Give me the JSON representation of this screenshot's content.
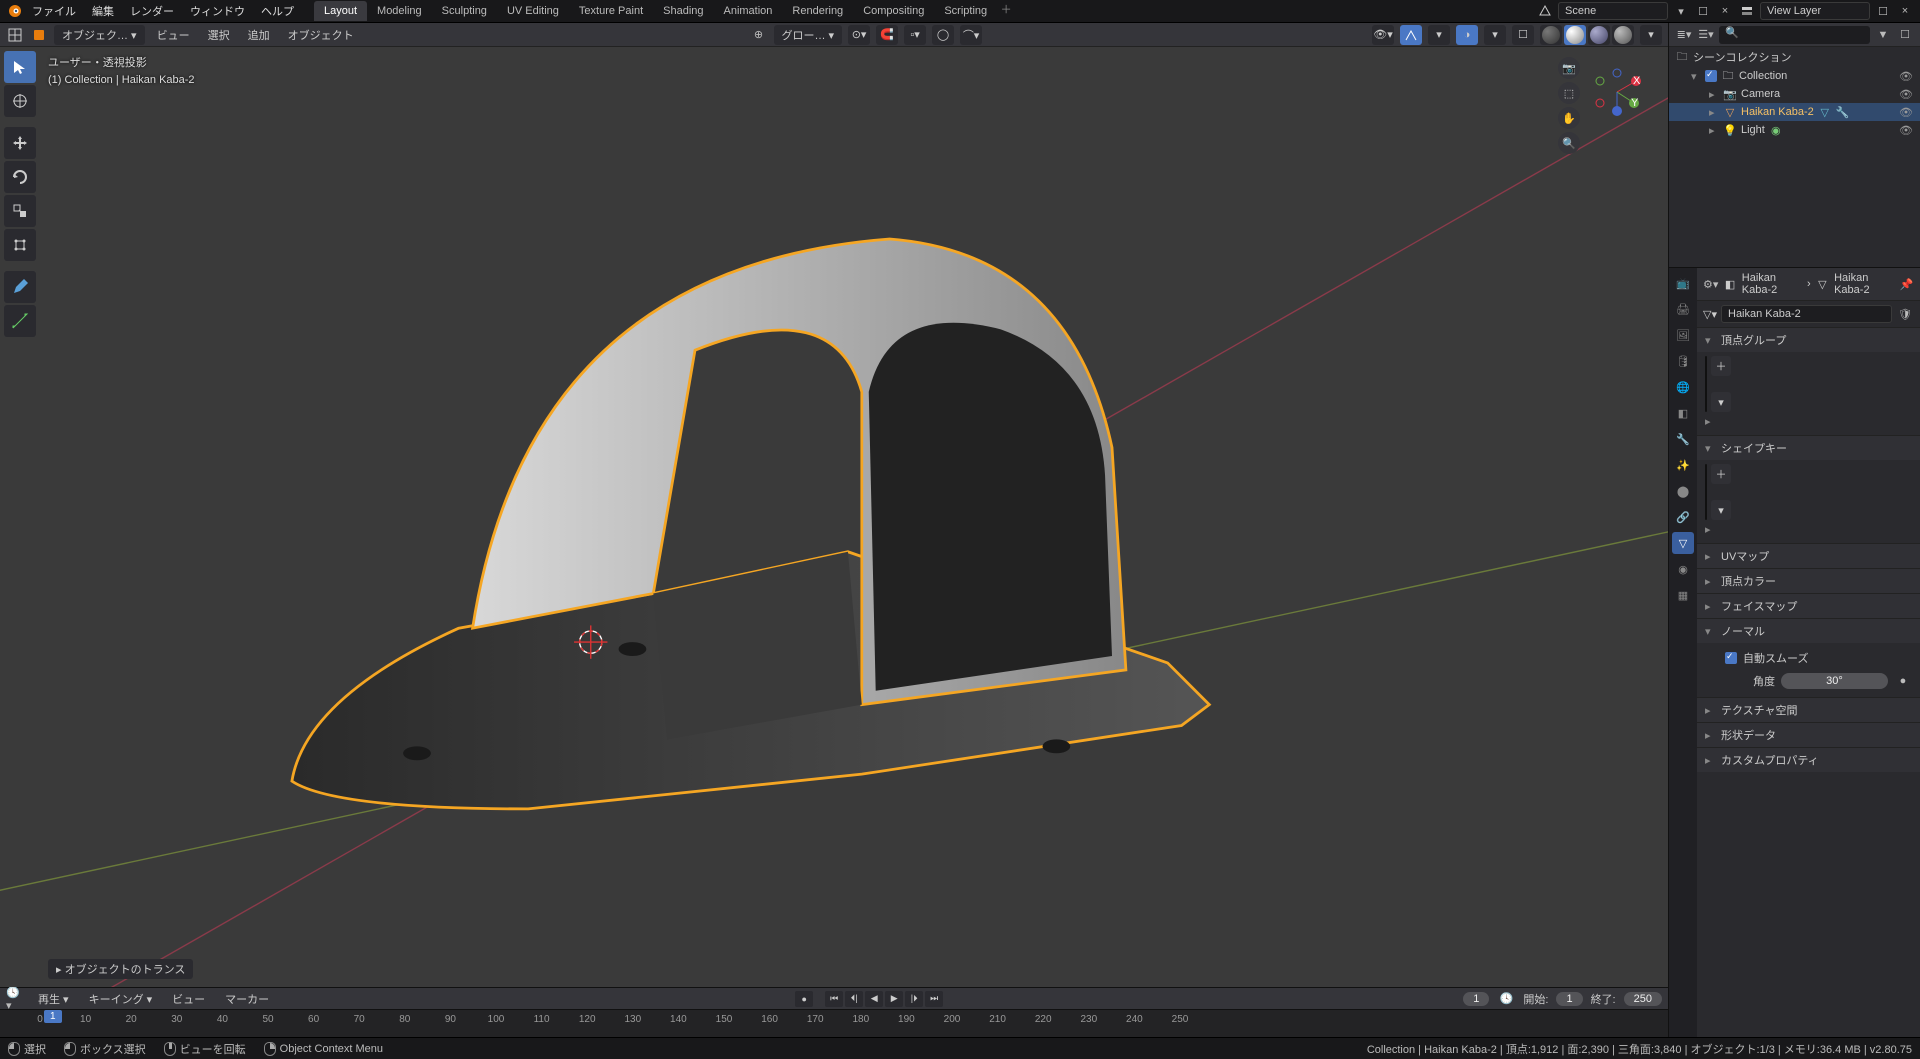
{
  "menus": {
    "file": "ファイル",
    "edit": "編集",
    "render": "レンダー",
    "window": "ウィンドウ",
    "help": "ヘルプ"
  },
  "workspaces": {
    "tabs": [
      "Layout",
      "Modeling",
      "Sculpting",
      "UV Editing",
      "Texture Paint",
      "Shading",
      "Animation",
      "Rendering",
      "Compositing",
      "Scripting"
    ],
    "active": "Layout"
  },
  "header": {
    "scene": "Scene",
    "viewlayer": "View Layer"
  },
  "viewport_header": {
    "mode": "オブジェク…",
    "menus": {
      "view": "ビュー",
      "select": "選択",
      "add": "追加",
      "object": "オブジェクト"
    },
    "orient": "グロー…"
  },
  "overlay": {
    "view_label": "ユーザー・透視投影",
    "context": "(1) Collection | Haikan Kaba-2"
  },
  "collapsed_panel": "オブジェクトのトランス",
  "outliner": {
    "root": "シーンコレクション",
    "collection": "Collection",
    "items": [
      {
        "name": "Camera",
        "icon": "camera"
      },
      {
        "name": "Haikan Kaba-2",
        "icon": "mesh",
        "active": true
      },
      {
        "name": "Light",
        "icon": "light"
      }
    ]
  },
  "props": {
    "breadcrumb": {
      "obj": "Haikan Kaba-2",
      "data": "Haikan Kaba-2"
    },
    "name_field": "Haikan Kaba-2",
    "panels": {
      "vertex_groups": "頂点グループ",
      "shape_keys": "シェイプキー",
      "uv_maps": "UVマップ",
      "vertex_colors": "頂点カラー",
      "face_maps": "フェイスマップ",
      "normals": "ノーマル",
      "auto_smooth": "自動スムーズ",
      "angle_label": "角度",
      "angle_value": "30°",
      "texture_space": "テクスチャ空間",
      "geometry_data": "形状データ",
      "custom_props": "カスタムプロパティ"
    }
  },
  "timeline": {
    "menus": {
      "playback": "再生",
      "keying": "キーイング",
      "view": "ビュー",
      "marker": "マーカー"
    },
    "current": "1",
    "start_label": "開始:",
    "start_val": "1",
    "end_label": "終了:",
    "end_val": "250",
    "ticks": [
      0,
      10,
      20,
      30,
      40,
      50,
      60,
      70,
      80,
      90,
      100,
      110,
      120,
      130,
      140,
      150,
      160,
      170,
      180,
      190,
      200,
      210,
      220,
      230,
      240,
      250
    ]
  },
  "status": {
    "select": "選択",
    "box": "ボックス選択",
    "rotate": "ビューを回転",
    "context_menu": "Object Context Menu",
    "stats": "Collection | Haikan Kaba-2 | 頂点:1,912 | 面:2,390 | 三角面:3,840 | オブジェクト:1/3 | メモリ:36.4 MB | v2.80.75"
  }
}
